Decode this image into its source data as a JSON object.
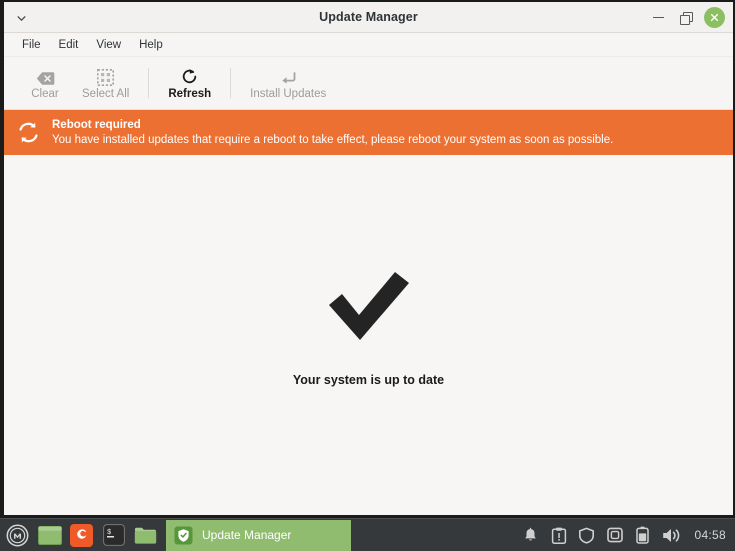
{
  "window": {
    "title": "Update Manager",
    "titlebar": {
      "menu_chevron_icon": "chevron-down-icon",
      "minimize_icon": "minimize-icon",
      "maximize_icon": "maximize-restore-icon",
      "close_icon": "close-icon",
      "close_button_color": "#8cbf62"
    },
    "menubar": [
      {
        "label": "File"
      },
      {
        "label": "Edit"
      },
      {
        "label": "View"
      },
      {
        "label": "Help"
      }
    ],
    "toolbar": [
      {
        "label": "Clear",
        "icon": "backspace-delete-icon",
        "enabled": false
      },
      {
        "label": "Select All",
        "icon": "select-all-dotted-box-icon",
        "enabled": false
      },
      {
        "label": "Refresh",
        "icon": "refresh-circular-arrow-icon",
        "enabled": true
      },
      {
        "label": "Install Updates",
        "icon": "return-arrow-icon",
        "enabled": false
      }
    ],
    "banner": {
      "icon": "reboot-sync-arrows-icon",
      "title": "Reboot required",
      "body": "You have installed updates that require a reboot to take effect, please reboot your system as soon as possible.",
      "background_color": "#ec7032",
      "text_color": "#ffffff"
    },
    "content": {
      "status_icon": "checkmark-icon",
      "status_text": "Your system is up to date",
      "background_color": "#f7f6f5"
    }
  },
  "taskbar": {
    "background_color": "#35393b",
    "launchers": [
      {
        "name": "mint-menu-icon",
        "label": "Menu"
      },
      {
        "name": "show-desktop-icon",
        "label": "Show Desktop"
      },
      {
        "name": "firefox-icon",
        "label": "Firefox"
      },
      {
        "name": "terminal-icon",
        "label": "Terminal"
      },
      {
        "name": "files-icon",
        "label": "Files"
      }
    ],
    "task_button": {
      "label": "Update Manager",
      "icon": "update-manager-shield-icon",
      "active": true,
      "background_color": "#8fbc6e"
    },
    "tray": [
      {
        "name": "notifications-bell-icon"
      },
      {
        "name": "update-manager-clipboard-icon"
      },
      {
        "name": "shield-icon"
      },
      {
        "name": "removable-drive-icon"
      },
      {
        "name": "battery-icon"
      },
      {
        "name": "volume-speaker-icon"
      }
    ],
    "clock": "04:58"
  }
}
